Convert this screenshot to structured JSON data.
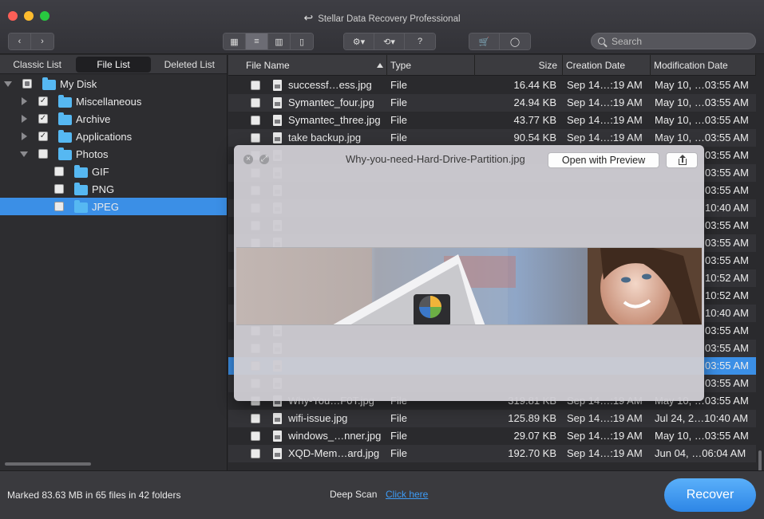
{
  "window": {
    "title": "Stellar Data Recovery Professional"
  },
  "toolbar": {
    "view_modes": [
      "icon-view",
      "list-view",
      "column-view",
      "coverflow-view"
    ],
    "active_view": "list-view",
    "search_placeholder": "Search"
  },
  "sidebar": {
    "tabs": [
      "Classic List",
      "File List",
      "Deleted List"
    ],
    "active_tab": "File List",
    "tree": [
      {
        "label": "My Disk",
        "depth": 0,
        "expanded": true,
        "check": "partial"
      },
      {
        "label": "Miscellaneous",
        "depth": 1,
        "expanded": false,
        "check": "checked"
      },
      {
        "label": "Archive",
        "depth": 1,
        "expanded": false,
        "check": "checked"
      },
      {
        "label": "Applications",
        "depth": 1,
        "expanded": false,
        "check": "checked"
      },
      {
        "label": "Photos",
        "depth": 1,
        "expanded": true,
        "check": "unchecked"
      },
      {
        "label": "GIF",
        "depth": 2,
        "check": "unchecked"
      },
      {
        "label": "PNG",
        "depth": 2,
        "check": "unchecked"
      },
      {
        "label": "JPEG",
        "depth": 2,
        "check": "unchecked",
        "selected": true
      }
    ]
  },
  "table": {
    "columns": [
      "File Name",
      "Type",
      "Size",
      "Creation Date",
      "Modification Date"
    ],
    "rows": [
      {
        "name": "successf…ess.jpg",
        "type": "File",
        "size": "16.44 KB",
        "created": "Sep 14…:19 AM",
        "modified": "May 10, …03:55 AM"
      },
      {
        "name": "Symantec_four.jpg",
        "type": "File",
        "size": "24.94 KB",
        "created": "Sep 14…:19 AM",
        "modified": "May 10, …03:55 AM"
      },
      {
        "name": "Symantec_three.jpg",
        "type": "File",
        "size": "43.77 KB",
        "created": "Sep 14…:19 AM",
        "modified": "May 10, …03:55 AM"
      },
      {
        "name": "take backup.jpg",
        "type": "File",
        "size": "90.54 KB",
        "created": "Sep 14…:19 AM",
        "modified": "May 10, …03:55 AM"
      },
      {
        "name": "",
        "type": "",
        "size": "",
        "created": "",
        "modified": "03:55 AM"
      },
      {
        "name": "",
        "type": "",
        "size": "",
        "created": "",
        "modified": "03:55 AM"
      },
      {
        "name": "",
        "type": "",
        "size": "",
        "created": "",
        "modified": "03:55 AM"
      },
      {
        "name": "",
        "type": "",
        "size": "",
        "created": "",
        "modified": "10:40 AM"
      },
      {
        "name": "",
        "type": "",
        "size": "",
        "created": "",
        "modified": "03:55 AM"
      },
      {
        "name": "",
        "type": "",
        "size": "",
        "created": "",
        "modified": "03:55 AM"
      },
      {
        "name": "",
        "type": "",
        "size": "",
        "created": "",
        "modified": "03:55 AM"
      },
      {
        "name": "",
        "type": "",
        "size": "",
        "created": "",
        "modified": "10:52 AM"
      },
      {
        "name": "",
        "type": "",
        "size": "",
        "created": "",
        "modified": "10:52 AM"
      },
      {
        "name": "",
        "type": "",
        "size": "",
        "created": "",
        "modified": "10:40 AM"
      },
      {
        "name": "",
        "type": "",
        "size": "",
        "created": "",
        "modified": "03:55 AM"
      },
      {
        "name": "",
        "type": "",
        "size": "",
        "created": "",
        "modified": "03:55 AM"
      },
      {
        "name": "",
        "type": "",
        "size": "",
        "created": "",
        "modified": "03:55 AM",
        "highlight": true
      },
      {
        "name": "",
        "type": "",
        "size": "",
        "created": "",
        "modified": "03:55 AM"
      },
      {
        "name": "Why-You…F0T.jpg",
        "type": "File",
        "size": "319.81 KB",
        "created": "Sep 14…:19 AM",
        "modified": "May 10, …03:55 AM"
      },
      {
        "name": "wifi-issue.jpg",
        "type": "File",
        "size": "125.89 KB",
        "created": "Sep 14…:19 AM",
        "modified": "Jul 24, 2…10:40 AM"
      },
      {
        "name": "windows_…nner.jpg",
        "type": "File",
        "size": "29.07 KB",
        "created": "Sep 14…:19 AM",
        "modified": "May 10, …03:55 AM"
      },
      {
        "name": "XQD-Mem…ard.jpg",
        "type": "File",
        "size": "192.70 KB",
        "created": "Sep 14…:19 AM",
        "modified": "Jun 04, …06:04 AM"
      }
    ]
  },
  "quicklook": {
    "filename": "Why-you-need-Hard-Drive-Partition.jpg",
    "open_label": "Open with Preview"
  },
  "footer": {
    "status": "Marked 83.63 MB in 65 files in 42 folders",
    "deep_scan_label": "Deep Scan",
    "click_here": "Click here",
    "recover_label": "Recover"
  },
  "colors": {
    "accent": "#3b8fe6",
    "folder": "#56b8f2"
  }
}
